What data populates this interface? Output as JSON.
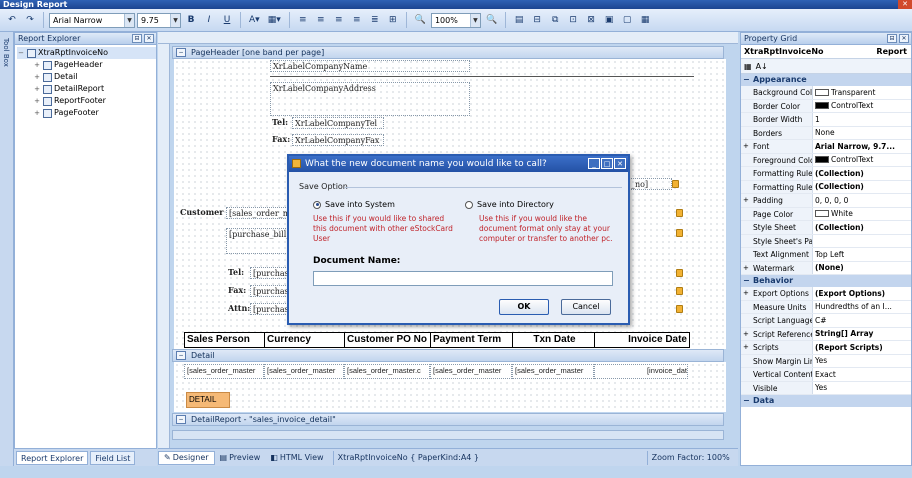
{
  "window": {
    "title": "Design Report"
  },
  "toolbar": {
    "font_name": "Arial Narrow",
    "font_size": "9.75",
    "zoom": "100%",
    "bold": "B",
    "italic": "I",
    "underline": "U"
  },
  "explorer": {
    "title": "Report Explorer",
    "toolbox_label": "Tool Box",
    "root": "XtraRptInvoiceNo",
    "items": [
      "PageHeader",
      "Detail",
      "DetailReport",
      "ReportFooter",
      "PageFooter"
    ],
    "tabs": [
      "Report Explorer",
      "Field List"
    ]
  },
  "designer": {
    "page_header_band": "PageHeader [one band per page]",
    "detail_band": "Detail",
    "detail_report_band": "DetailReport - \"sales_invoice_detail\"",
    "labels": {
      "company_name": "XrLabelCompanyName",
      "company_address": "XrLabelCompanyAddress",
      "tel_caption": "Tel:",
      "tel_value": "XrLabelCompanyTel",
      "fax_caption": "Fax:",
      "fax_value": "XrLabelCompanyFax",
      "customer_caption": "Customer:",
      "customer_value": "[sales_order_mas",
      "bill_value": "[purchase_bill_ma",
      "tel2_caption": "Tel:",
      "tel2_value": "[purchase_",
      "fax2_caption": "Fax:",
      "fax2_value": "[purchase_",
      "attn_caption": "Attn:",
      "attn_value": "[purchase_",
      "right_field": "_no]",
      "detail_label": "DETAIL"
    },
    "header_columns": [
      "Sales Person",
      "Currency",
      "Customer PO No",
      "Payment Term",
      "Txn Date",
      "Invoice Date"
    ],
    "detail_cells": [
      "[sales_order_master",
      "[sales_order_master",
      "[sales_order_master.c",
      "[sales_order_master",
      "[sales_order_master",
      "[invoice_dat"
    ],
    "tabs": [
      "Designer",
      "Preview",
      "HTML View"
    ],
    "doc_info": "XtraRptInvoiceNo { PaperKind:A4 }",
    "zoom_factor": "Zoom Factor: 100%"
  },
  "dialog": {
    "title": "What the new document name you would like to call?",
    "group_label": "Save Option",
    "option_system": "Save into System",
    "option_directory": "Save into Directory",
    "note_system": "Use this if you would like to shared this document with other eStockCard User",
    "note_directory": "Use this if you would like the document format only stay at your computer or transfer to another pc.",
    "doc_name_label": "Document Name:",
    "doc_name_value": "",
    "ok_label": "OK",
    "cancel_label": "Cancel"
  },
  "propgrid": {
    "title": "Property Grid",
    "object_name": "XtraRptInvoiceNo",
    "object_type": "Report",
    "categories": [
      {
        "name": "Appearance",
        "rows": [
          {
            "name": "Background Color",
            "value": "Transparent",
            "swatch": "#ffffff"
          },
          {
            "name": "Border Color",
            "value": "ControlText",
            "swatch": "#000000"
          },
          {
            "name": "Border Width",
            "value": "1"
          },
          {
            "name": "Borders",
            "value": "None"
          },
          {
            "name": "Font",
            "value": "Arial Narrow, 9.7...",
            "bold": true,
            "expandable": true
          },
          {
            "name": "Foreground Color",
            "value": "ControlText",
            "swatch": "#000000"
          },
          {
            "name": "Formatting Rule S",
            "value": "(Collection)",
            "bold": true
          },
          {
            "name": "Formatting Rules",
            "value": "(Collection)",
            "bold": true
          },
          {
            "name": "Padding",
            "value": "0, 0, 0, 0",
            "expandable": true
          },
          {
            "name": "Page Color",
            "value": "White",
            "swatch": "#ffffff"
          },
          {
            "name": "Style Sheet",
            "value": "(Collection)",
            "bold": true
          },
          {
            "name": "Style Sheet's Pat",
            "value": ""
          },
          {
            "name": "Text Alignment",
            "value": "Top Left"
          },
          {
            "name": "Watermark",
            "value": "(None)",
            "bold": true,
            "expandable": true
          }
        ]
      },
      {
        "name": "Behavior",
        "rows": [
          {
            "name": "Export Options",
            "value": "(Export Options)",
            "bold": true,
            "expandable": true
          },
          {
            "name": "Measure Units",
            "value": "Hundredths of an I..."
          },
          {
            "name": "Script Language",
            "value": "C#"
          },
          {
            "name": "Script References",
            "value": "String[] Array",
            "bold": true,
            "expandable": true
          },
          {
            "name": "Scripts",
            "value": "(Report Scripts)",
            "bold": true,
            "expandable": true
          },
          {
            "name": "Show Margin Lines",
            "value": "Yes"
          },
          {
            "name": "Vertical Content",
            "value": "Exact"
          },
          {
            "name": "Visible",
            "value": "Yes"
          }
        ]
      },
      {
        "name": "Data",
        "rows": []
      }
    ]
  }
}
